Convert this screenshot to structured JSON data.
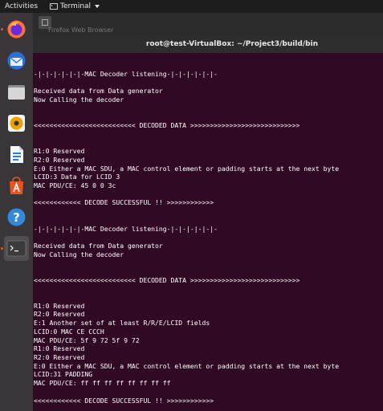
{
  "topbar": {
    "activities": "Activities",
    "app_name": "Terminal"
  },
  "dock": {
    "items": [
      {
        "icon": "firefox-icon",
        "running": true
      },
      {
        "icon": "thunderbird-icon",
        "running": false
      },
      {
        "icon": "files-icon",
        "running": false
      },
      {
        "icon": "rhythmbox-icon",
        "running": false
      },
      {
        "icon": "libreoffice-writer-icon",
        "running": false
      },
      {
        "icon": "software-center-icon",
        "running": false
      },
      {
        "icon": "help-icon",
        "running": false
      },
      {
        "icon": "terminal-icon",
        "running": true,
        "active": true
      }
    ]
  },
  "background_window": {
    "tooltip": "Firefox Web Browser"
  },
  "terminal": {
    "title": "root@test-VirtualBox: ~/Project3/build/bin",
    "lines": [
      "-|-|-|-|-|-|-MAC Decoder listening-|-|-|-|-|-|-",
      "",
      "Received data from Data generator",
      "Now Calling the decoder",
      "",
      "",
      "<<<<<<<<<<<<<<<<<<<<<<<<<< DECODED DATA >>>>>>>>>>>>>>>>>>>>>>>>>>>>",
      "",
      "",
      "R1:0 Reserved",
      "R2:0 Reserved",
      "E:0 Either a MAC SDU, a MAC control element or padding starts at the next byte",
      "LCID:3 Data for LCID 3",
      "MAC PDU/CE: 45 0 0 3c",
      "",
      "<<<<<<<<<<<< DECODE SUCCESSFUL !! >>>>>>>>>>>>",
      "",
      "",
      "-|-|-|-|-|-|-MAC Decoder listening-|-|-|-|-|-|-",
      "",
      "Received data from Data generator",
      "Now Calling the decoder",
      "",
      "",
      "<<<<<<<<<<<<<<<<<<<<<<<<<< DECODED DATA >>>>>>>>>>>>>>>>>>>>>>>>>>>>",
      "",
      "",
      "R1:0 Reserved",
      "R2:0 Reserved",
      "E:1 Another set of at least R/R/E/LCID fields",
      "LCID:0 MAC CE CCCH",
      "MAC PDU/CE: 5f 9 72 5f 9 72",
      "R1:0 Reserved",
      "R2:0 Reserved",
      "E:0 Either a MAC SDU, a MAC control element or padding starts at the next byte",
      "LCID:31 PADDING",
      "MAC PDU/CE: ff ff ff ff ff ff ff ff",
      "",
      "<<<<<<<<<<<< DECODE SUCCESSFUL !! >>>>>>>>>>>>"
    ]
  },
  "colors": {
    "terminal_bg": "#300a24",
    "terminal_fg": "#ffffff",
    "accent": "#e95420"
  }
}
